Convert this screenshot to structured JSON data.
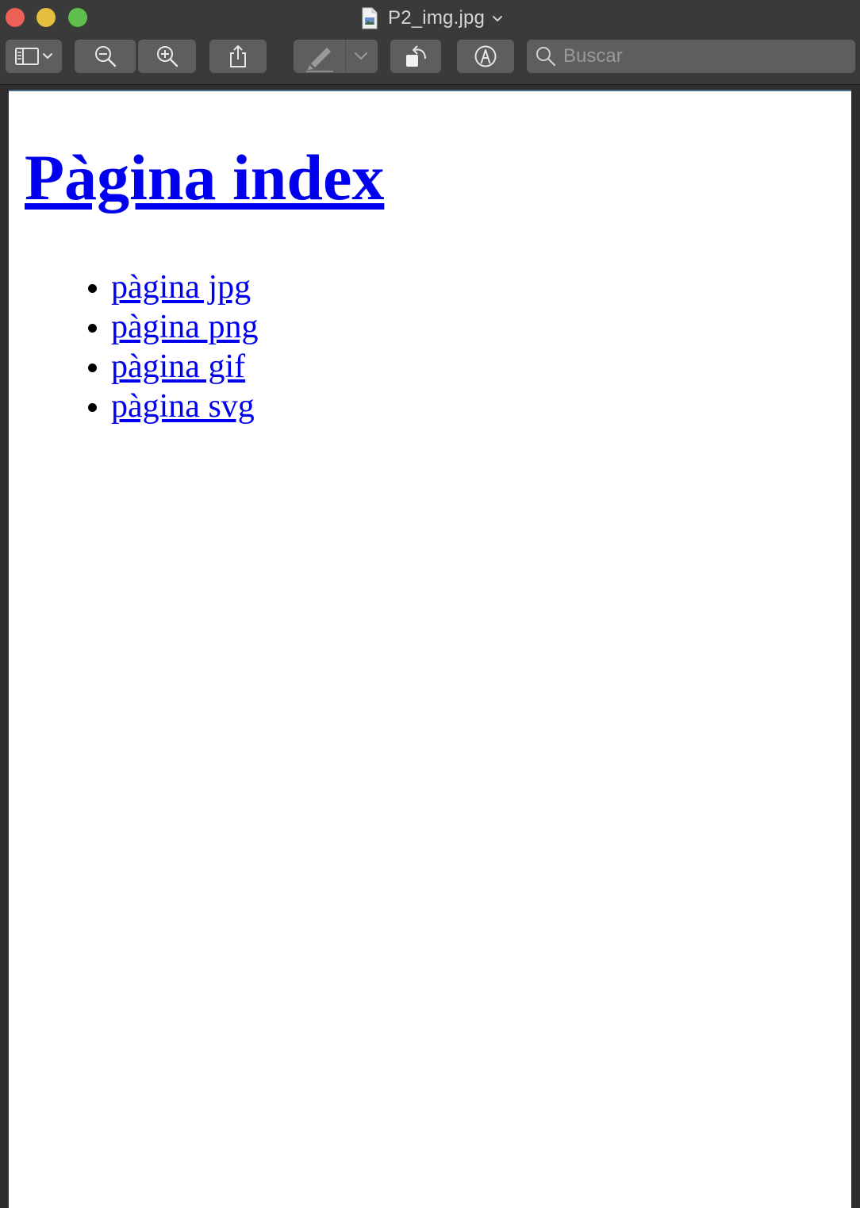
{
  "window": {
    "title": "P2_img.jpg"
  },
  "toolbar": {
    "buttons": [
      {
        "name": "sidebar-toggle",
        "icon": "sidebar-icon"
      },
      {
        "name": "zoom-out",
        "icon": "zoom-out-icon"
      },
      {
        "name": "zoom-in",
        "icon": "zoom-in-icon"
      },
      {
        "name": "share",
        "icon": "share-icon"
      },
      {
        "name": "highlight",
        "icon": "highlighter-icon"
      },
      {
        "name": "rotate",
        "icon": "rotate-icon"
      },
      {
        "name": "markup",
        "icon": "markup-icon"
      }
    ],
    "search": {
      "placeholder": "Buscar",
      "value": ""
    }
  },
  "document": {
    "heading": "Pàgina index",
    "links": [
      {
        "label": "pàgina jpg"
      },
      {
        "label": "pàgina png"
      },
      {
        "label": "pàgina gif"
      },
      {
        "label": "pàgina svg"
      }
    ]
  },
  "colors": {
    "link": "#0000ee",
    "close": "#ee5f58",
    "minimize": "#e5bd3f",
    "maximize": "#5fc04e",
    "toolbar": "#3a3a3a",
    "button": "#5e5e5e"
  }
}
